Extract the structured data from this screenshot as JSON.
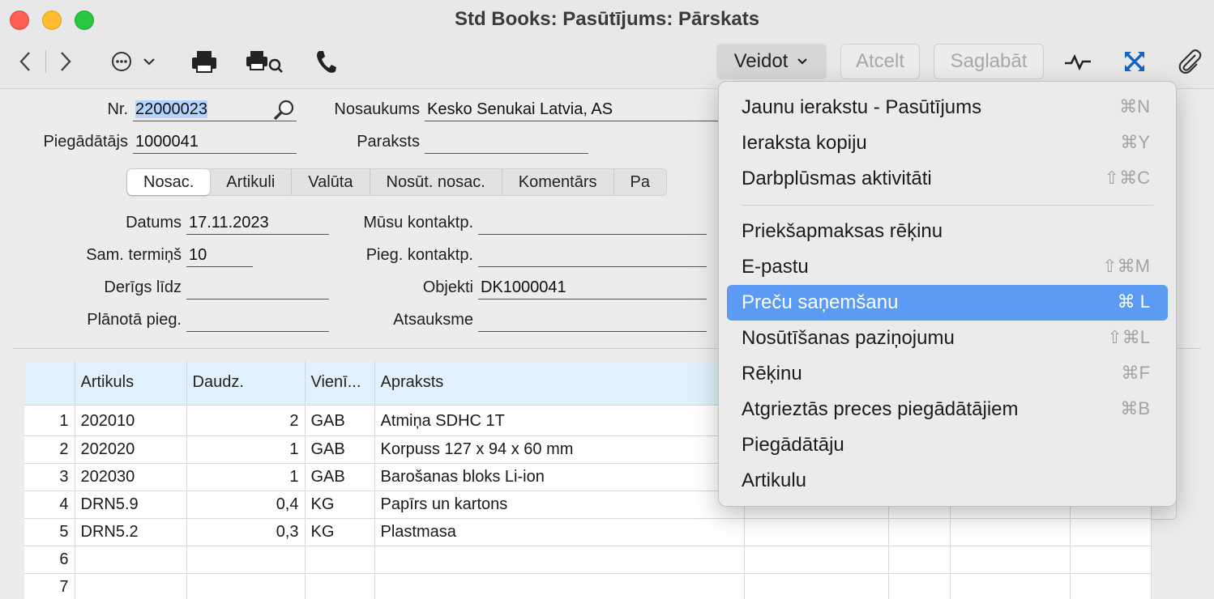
{
  "window": {
    "title": "Std Books: Pasūtījums: Pārskats"
  },
  "toolbar": {
    "veidot_label": "Veidot",
    "atcelt_label": "Atcelt",
    "saglabat_label": "Saglabāt"
  },
  "header": {
    "nr_label": "Nr.",
    "nr_value": "22000023",
    "nosaukums_label": "Nosaukums",
    "nosaukums_value": "Kesko Senukai Latvia, AS",
    "piegadatajs_label": "Piegādātājs",
    "piegadatajs_value": "1000041",
    "paraksts_label": "Paraksts",
    "paraksts_value": ""
  },
  "tabs": [
    "Nosac.",
    "Artikuli",
    "Valūta",
    "Nosūt. nosac.",
    "Komentārs",
    "Pa"
  ],
  "details": {
    "datums_label": "Datums",
    "datums_value": "17.11.2023",
    "sam_termins_label": "Sam. termiņš",
    "sam_termins_value": "10",
    "derigs_lidz_label": "Derīgs līdz",
    "derigs_lidz_value": "",
    "planota_pieg_label": "Plānotā pieg.",
    "planota_pieg_value": "",
    "musu_kontaktp_label": "Mūsu kontaktp.",
    "musu_kontaktp_value": "",
    "pieg_kontaktp_label": "Pieg. kontaktp.",
    "pieg_kontaktp_value": "",
    "objekti_label": "Objekti",
    "objekti_value": "DK1000041",
    "atsauksme_label": "Atsauksme",
    "atsauksme_value": ""
  },
  "grid": {
    "columns": [
      "",
      "Artikuls",
      "Daudz.",
      "Vienī...",
      "Apraksts"
    ],
    "rows": [
      {
        "n": "1",
        "artikuls": "202010",
        "daudz": "2",
        "vien": "GAB",
        "apraksts": "Atmiņa SDHC 1T"
      },
      {
        "n": "2",
        "artikuls": "202020",
        "daudz": "1",
        "vien": "GAB",
        "apraksts": "Korpuss 127 x 94 x 60 mm"
      },
      {
        "n": "3",
        "artikuls": "202030",
        "daudz": "1",
        "vien": "GAB",
        "apraksts": "Barošanas bloks Li-ion"
      },
      {
        "n": "4",
        "artikuls": "DRN5.9",
        "daudz": "0,4",
        "vien": "KG",
        "apraksts": "Papīrs un kartons"
      },
      {
        "n": "5",
        "artikuls": "DRN5.2",
        "daudz": "0,3",
        "vien": "KG",
        "apraksts": "Plastmasa"
      },
      {
        "n": "6",
        "artikuls": "",
        "daudz": "",
        "vien": "",
        "apraksts": ""
      },
      {
        "n": "7",
        "artikuls": "",
        "daudz": "",
        "vien": "",
        "apraksts": ""
      }
    ]
  },
  "menu": {
    "items": [
      {
        "label": "Jaunu ierakstu - Pasūtījums",
        "shortcut": "⌘N"
      },
      {
        "label": "Ieraksta kopiju",
        "shortcut": "⌘Y"
      },
      {
        "label": "Darbplūsmas aktivitāti",
        "shortcut": "⇧⌘C"
      },
      {
        "label": "Priekšapmaksas rēķinu",
        "shortcut": ""
      },
      {
        "label": "E-pastu",
        "shortcut": "⇧⌘M"
      },
      {
        "label": "Preču saņemšanu",
        "shortcut": "⌘ L"
      },
      {
        "label": "Nosūtīšanas paziņojumu",
        "shortcut": "⇧⌘L"
      },
      {
        "label": "Rēķinu",
        "shortcut": "⌘F"
      },
      {
        "label": "Atgrieztās preces piegādātājiem",
        "shortcut": "⌘B"
      },
      {
        "label": "Piegādātāju",
        "shortcut": ""
      },
      {
        "label": "Artikulu",
        "shortcut": ""
      }
    ]
  }
}
